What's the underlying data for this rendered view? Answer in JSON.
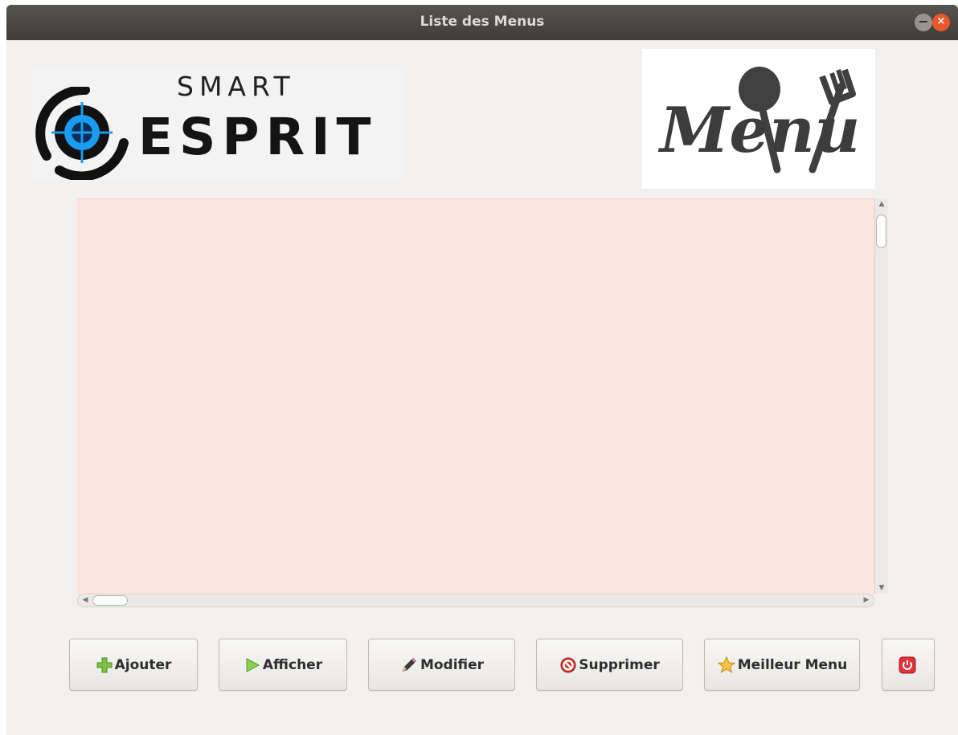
{
  "window": {
    "title": "Liste des Menus",
    "minimize_glyph": "−",
    "close_glyph": "×"
  },
  "logo_smart": {
    "top_text": "SMART",
    "main_text": "ESPRIT"
  },
  "logo_menu": {
    "text": "Menu"
  },
  "buttons": {
    "add_label": "Ajouter",
    "show_label": "Afficher",
    "edit_label": "Modifier",
    "delete_label": "Supprimer",
    "best_label": "Meilleur Menu"
  },
  "colors": {
    "table_bg": "#fbe6df",
    "window_bg": "#f2f1f0",
    "titlebar": "#3f3d39",
    "close_btn": "#e9572b"
  },
  "icons": {
    "add": "green-plus-icon",
    "show": "green-play-icon",
    "edit": "pencil-icon",
    "delete": "red-stop-icon",
    "best": "gold-star-icon",
    "exit": "power-icon"
  }
}
